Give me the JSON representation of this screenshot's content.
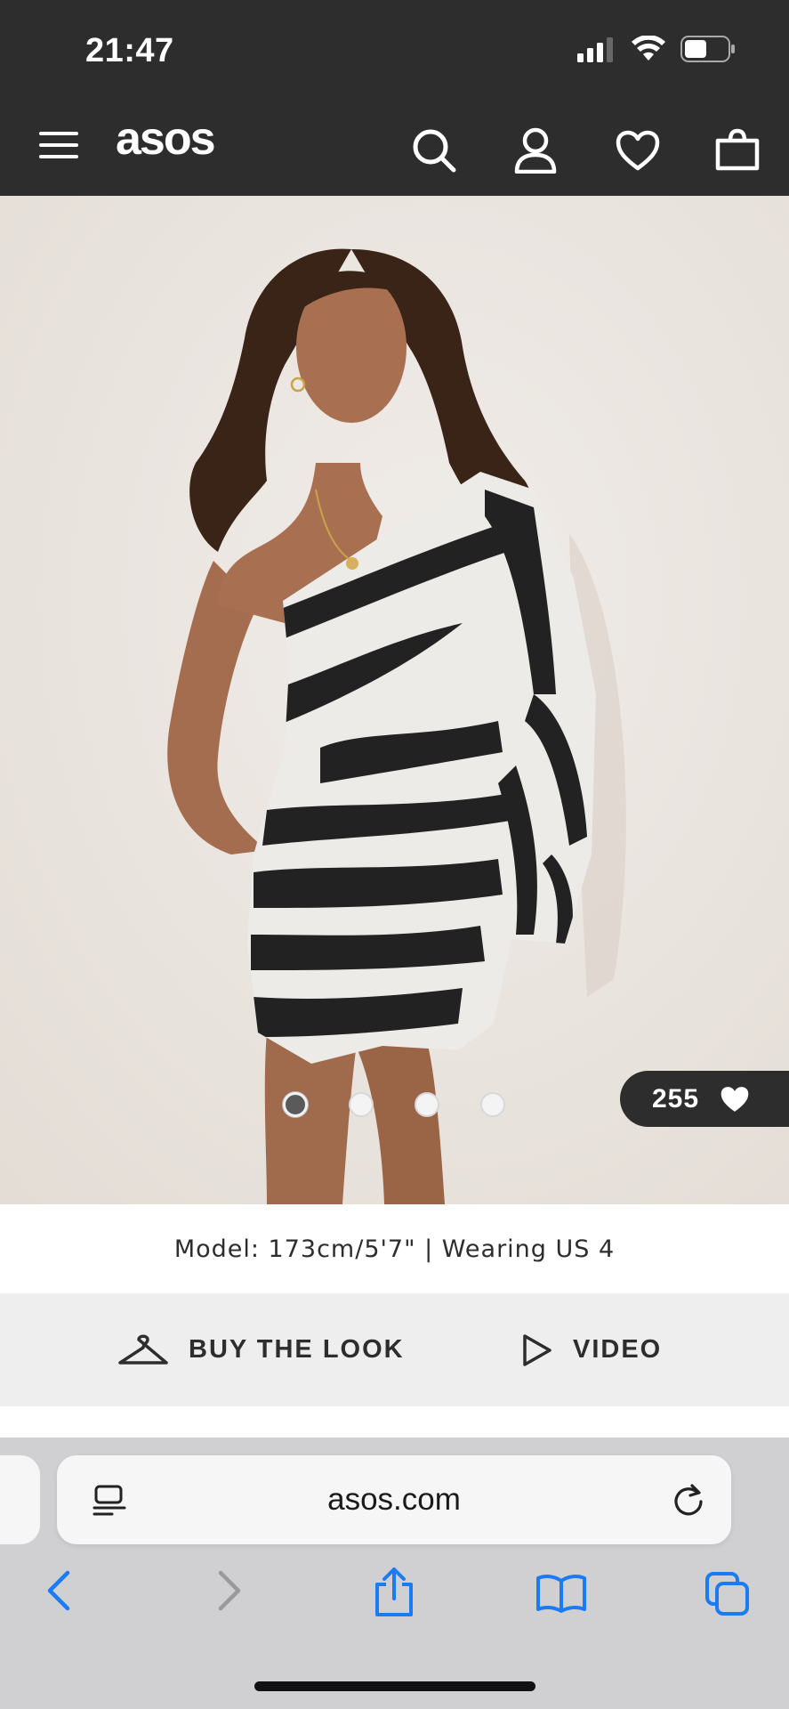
{
  "status_bar": {
    "time": "21:47"
  },
  "header": {
    "logo": "asos",
    "icons": [
      "menu-icon",
      "search-icon",
      "account-icon",
      "heart-icon",
      "bag-icon"
    ]
  },
  "product": {
    "image_alt": "Model wearing black and white zebra print one shoulder mini dress",
    "gallery": {
      "count": 4,
      "active_index": 0
    },
    "likes": "255",
    "model_info": "Model: 173cm/5'7\" | Wearing US 4"
  },
  "actions": {
    "buy_the_look": "BUY THE LOOK",
    "video": "VIDEO"
  },
  "browser": {
    "url": "asos.com"
  },
  "colors": {
    "header_bg": "#2d2d2d",
    "accent_blue": "#1a7cf5",
    "action_bar_bg": "#eeeeee"
  }
}
